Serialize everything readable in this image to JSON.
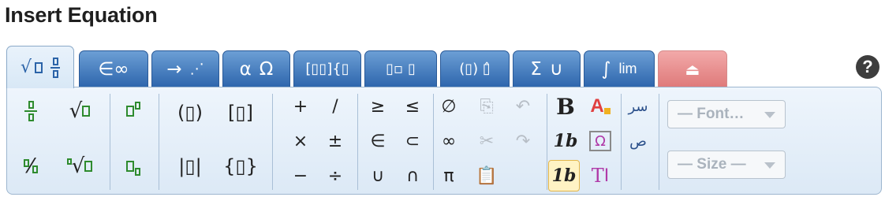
{
  "title": "Insert Equation",
  "tabs": [
    {
      "id": "templates",
      "icon": "√▯",
      "icon2": "▯/▯",
      "active": true
    },
    {
      "id": "symbols",
      "icon": "∈∞",
      "icon2": ""
    },
    {
      "id": "arrows",
      "icon": "→",
      "icon2": "⋰"
    },
    {
      "id": "greek",
      "icon": "α",
      "icon2": "Ω"
    },
    {
      "id": "matrices",
      "icon": "[▯▯]",
      "icon2": "{▯"
    },
    {
      "id": "scripts",
      "icon": "▯▯",
      "icon2": "▯"
    },
    {
      "id": "accents",
      "icon": "(▯)",
      "icon2": "▯̂"
    },
    {
      "id": "operators",
      "icon": "Σ",
      "icon2": "∪"
    },
    {
      "id": "calculus",
      "icon": "∫",
      "icon2": "lim"
    },
    {
      "id": "insert",
      "icon": "⏏",
      "icon2": "",
      "disabled": true
    }
  ],
  "help_label": "?",
  "buttons": {
    "paren": "(▯)",
    "bracket": "[▯]",
    "abs": "|▯|",
    "brace": "{▯}",
    "ops": [
      "+",
      "/",
      "×",
      "±",
      "−",
      "÷"
    ],
    "rel": [
      "≥",
      "≤",
      "∈",
      "⊂",
      "∪",
      "∩"
    ],
    "misc": [
      "∅",
      "∞",
      "π"
    ],
    "bold": "B",
    "italic": "1b",
    "italic2": "1b",
    "greek_box": "Ω",
    "text": "T",
    "font_placeholder": "— Font… ▾",
    "size_placeholder": "— Size — ▾"
  },
  "font_select": "— Font…",
  "size_select": "— Size —"
}
